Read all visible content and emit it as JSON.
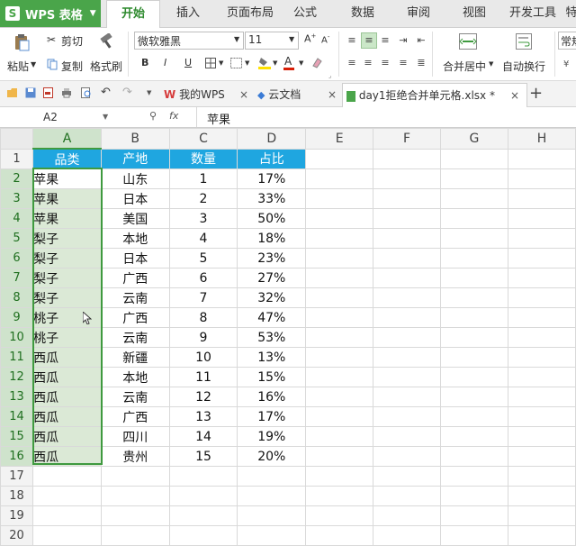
{
  "app": {
    "title": "WPS 表格",
    "icon": "wps-s-icon"
  },
  "menu": {
    "tabs": [
      "开始",
      "插入",
      "页面布局",
      "公式",
      "数据",
      "审阅",
      "视图",
      "开发工具",
      "特"
    ],
    "active": "开始"
  },
  "ribbon": {
    "paste_label": "粘贴",
    "cut_label": "剪切",
    "copy_label": "复制",
    "format_painter_label": "格式刷",
    "font_name": "微软雅黑",
    "font_size": "11",
    "bold": "B",
    "italic": "I",
    "underline": "U",
    "merge_center_label": "合并居中",
    "wrap_text_label": "自动换行",
    "number_format": "常规",
    "font_color": "#d81e06",
    "fill_color": "#ffe100"
  },
  "doc_tabs": [
    {
      "label": "我的WPS",
      "icon": "wps-w-icon"
    },
    {
      "label": "云文档",
      "icon": "cloud-doc-icon"
    },
    {
      "label": "day1拒绝合并单元格.xlsx *",
      "icon": "sheet-file-icon",
      "active": true
    }
  ],
  "formula_bar": {
    "name_box": "A2",
    "fx": "fx",
    "value": "苹果"
  },
  "sheet": {
    "columns": [
      "A",
      "B",
      "C",
      "D",
      "E",
      "F",
      "G",
      "H"
    ],
    "selected_column": "A",
    "row_numbers": [
      "1",
      "2",
      "3",
      "4",
      "5",
      "6",
      "7",
      "8",
      "9",
      "10",
      "11",
      "12",
      "13",
      "14",
      "15",
      "16",
      "17",
      "18",
      "19",
      "20"
    ],
    "header": [
      "品类",
      "产地",
      "数量",
      "占比"
    ],
    "header_color": "#1fa6e0",
    "rows": [
      [
        "苹果",
        "山东",
        "1",
        "17%"
      ],
      [
        "苹果",
        "日本",
        "2",
        "33%"
      ],
      [
        "苹果",
        "美国",
        "3",
        "50%"
      ],
      [
        "梨子",
        "本地",
        "4",
        "18%"
      ],
      [
        "梨子",
        "日本",
        "5",
        "23%"
      ],
      [
        "梨子",
        "广西",
        "6",
        "27%"
      ],
      [
        "梨子",
        "云南",
        "7",
        "32%"
      ],
      [
        "桃子",
        "广西",
        "8",
        "47%"
      ],
      [
        "桃子",
        "云南",
        "9",
        "53%"
      ],
      [
        "西瓜",
        "新疆",
        "10",
        "13%"
      ],
      [
        "西瓜",
        "本地",
        "11",
        "15%"
      ],
      [
        "西瓜",
        "云南",
        "12",
        "16%"
      ],
      [
        "西瓜",
        "广西",
        "13",
        "17%"
      ],
      [
        "西瓜",
        "四川",
        "14",
        "19%"
      ],
      [
        "西瓜",
        "贵州",
        "15",
        "20%"
      ]
    ],
    "active_cell": "A2",
    "selection": "A2:A16"
  }
}
